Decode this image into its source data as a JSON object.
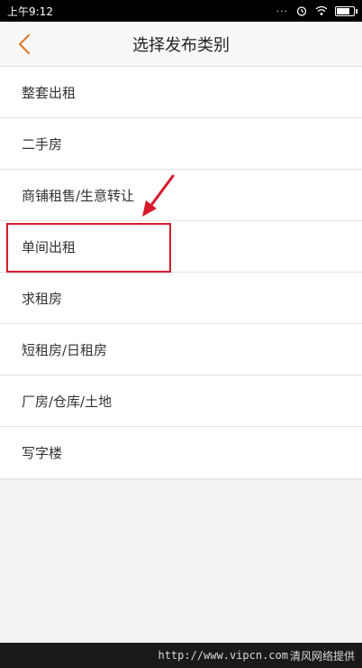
{
  "status_bar": {
    "time": "上午9:12"
  },
  "header": {
    "title": "选择发布类别",
    "back_icon": "chevron-left-icon"
  },
  "categories": [
    {
      "label": "整套出租"
    },
    {
      "label": "二手房"
    },
    {
      "label": "商铺租售/生意转让"
    },
    {
      "label": "单间出租"
    },
    {
      "label": "求租房"
    },
    {
      "label": "短租房/日租房"
    },
    {
      "label": "厂房/仓库/土地"
    },
    {
      "label": "写字楼"
    }
  ],
  "watermark": {
    "url": "http://www.vipcn.com",
    "text": "清风网络提供"
  },
  "colors": {
    "accent": "#e07a2e",
    "annotation": "#d71a2a"
  }
}
